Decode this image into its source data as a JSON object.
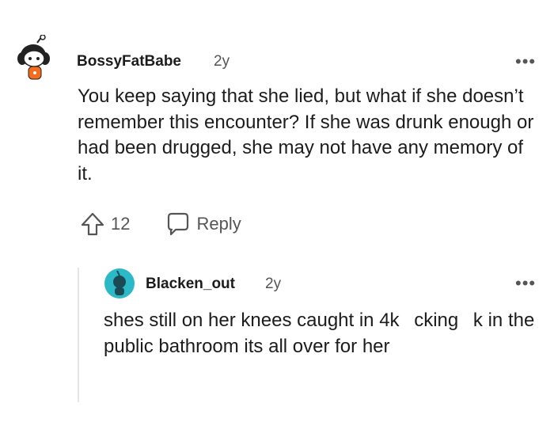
{
  "comments": [
    {
      "username": "BossyFatBabe",
      "age": "2y",
      "text": "You keep saying that she lied, but what if she doesn’t remember this encounter? If she was drunk enough or had been drugged, she may not have any memory of it.",
      "upvotes": "12",
      "reply_label": "Reply",
      "more_label": "•••"
    },
    {
      "username": "Blacken_out",
      "age": "2y",
      "text_parts": [
        "shes still on her knees caught in 4k ",
        "cking ",
        "k in the public bathroom its all over for her"
      ],
      "more_label": "•••"
    }
  ],
  "icons": {
    "upvote": "arrow-up-outline-icon",
    "reply": "speech-bubble-icon",
    "more": "ellipsis-icon"
  },
  "colors": {
    "avatar_bg_2": "#2bb9c7",
    "avatar_shirt_1": "#f46c1e"
  }
}
